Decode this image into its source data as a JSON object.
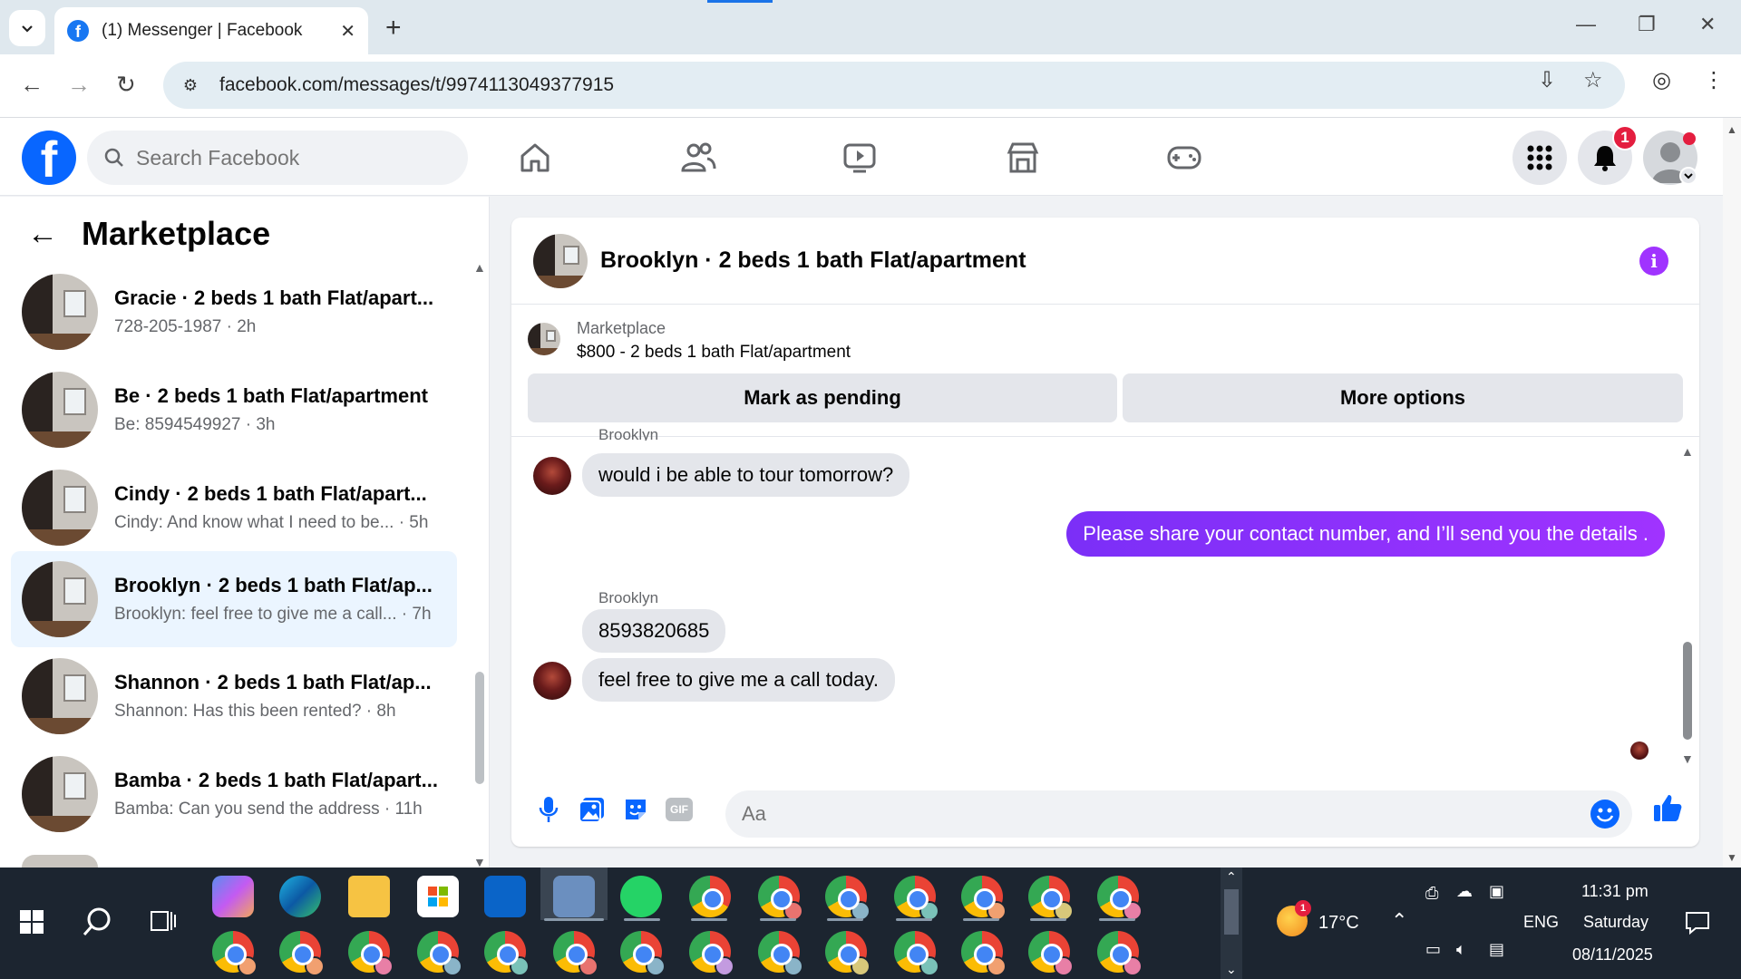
{
  "browser": {
    "tab_title": "(1) Messenger | Facebook",
    "url": "facebook.com/messages/t/9974113049377915"
  },
  "facebook": {
    "search_placeholder": "Search Facebook",
    "notification_count": "1"
  },
  "sidebar": {
    "title": "Marketplace",
    "conversations": [
      {
        "name": "Gracie · 2 beds 1 bath Flat/apart...",
        "preview": "728-205-1987 · 2h"
      },
      {
        "name": "Be · 2 beds 1 bath Flat/apartment",
        "preview": "Be: 8594549927 · 3h"
      },
      {
        "name": "Cindy · 2 beds 1 bath Flat/apart...",
        "preview": "Cindy: And know what I need to be... · 5h"
      },
      {
        "name": "Brooklyn · 2 beds 1 bath Flat/ap...",
        "preview": "Brooklyn: feel free to give me a call... · 7h"
      },
      {
        "name": "Shannon · 2 beds 1 bath Flat/ap...",
        "preview": "Shannon: Has this been rented? · 8h"
      },
      {
        "name": "Bamba · 2 beds 1 bath Flat/apart...",
        "preview": "Bamba: Can you send the address · 11h"
      }
    ]
  },
  "chat": {
    "title": "Brooklyn · 2 beds 1 bath Flat/apartment",
    "listing_source": "Marketplace",
    "listing_price": "$800 - 2 beds 1 bath Flat/apartment",
    "mark_pending_label": "Mark as pending",
    "more_options_label": "More options",
    "messages": {
      "partial_sender": "Brooklyn",
      "msg1": "would i be able to tour tomorrow?",
      "msg2": "Please share your contact number, and I’ll send you the details .",
      "sender": "Brooklyn",
      "msg3": "8593820685",
      "msg4": "feel free to give me a call today."
    },
    "composer_placeholder": "Aa",
    "gif_label": "GIF"
  },
  "taskbar": {
    "temperature": "17°C",
    "language": "ENG",
    "time": "11:31 pm",
    "day": "Saturday",
    "date": "08/11/2025"
  },
  "colors": {
    "facebook_blue": "#0866ff",
    "outgoing_bubble": "#8a2be2",
    "active_conversation": "#ebf5ff"
  }
}
